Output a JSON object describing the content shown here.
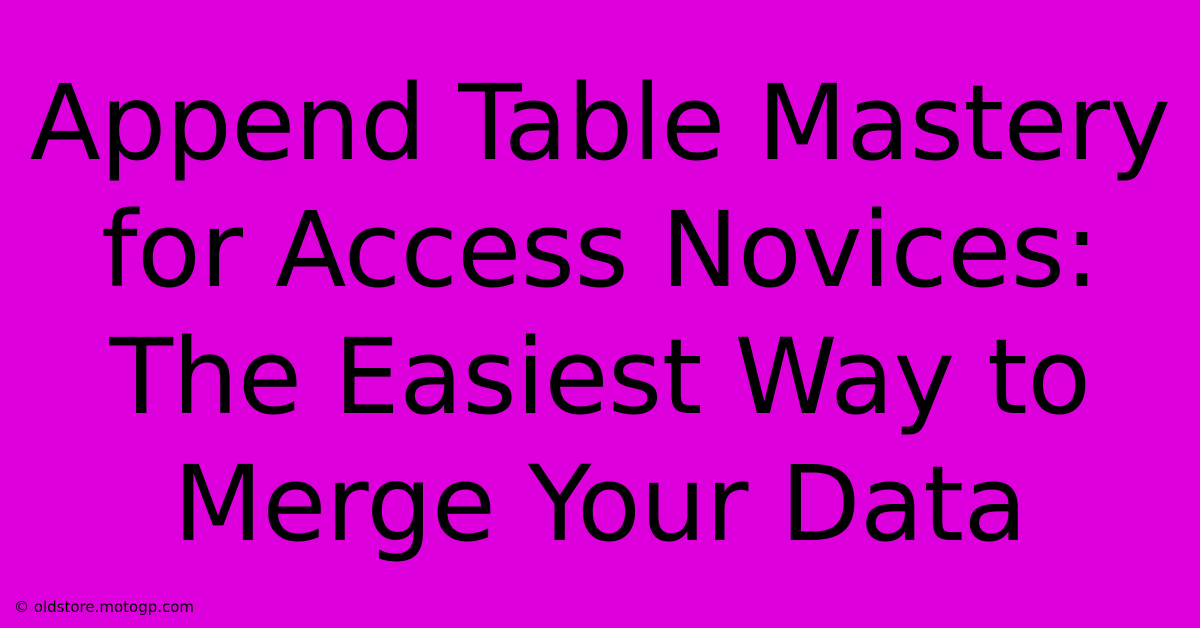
{
  "main": {
    "title": "Append Table Mastery for Access Novices: The Easiest Way to Merge Your Data"
  },
  "footer": {
    "attribution": "© oldstore.motogp.com"
  },
  "colors": {
    "background": "#DD00DD",
    "text": "#000000"
  }
}
